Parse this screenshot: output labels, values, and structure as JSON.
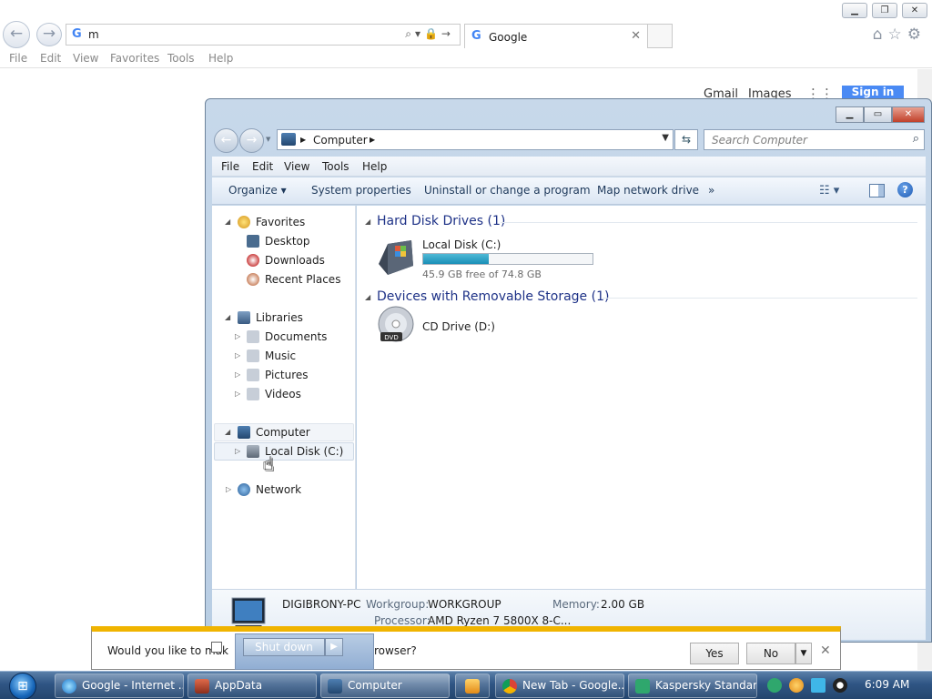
{
  "browser": {
    "address_value": "m",
    "tab_title": "Google",
    "menu": [
      "File",
      "Edit",
      "View",
      "Favorites",
      "Tools",
      "Help"
    ],
    "google_links": [
      "Gmail",
      "Images"
    ],
    "google_signin": "Sign in"
  },
  "explorer": {
    "breadcrumb": "Computer",
    "search_placeholder": "Search Computer",
    "menu": [
      "File",
      "Edit",
      "View",
      "Tools",
      "Help"
    ],
    "toolbar": [
      "Organize ▾",
      "System properties",
      "Uninstall or change a program",
      "Map network drive",
      "»"
    ],
    "nav": {
      "favorites": {
        "label": "Favorites",
        "items": [
          "Desktop",
          "Downloads",
          "Recent Places"
        ]
      },
      "libraries": {
        "label": "Libraries",
        "items": [
          "Documents",
          "Music",
          "Pictures",
          "Videos"
        ]
      },
      "computer": {
        "label": "Computer",
        "items": [
          "Local Disk (C:)"
        ]
      },
      "network": {
        "label": "Network"
      }
    },
    "groups": {
      "hdd_title": "Hard Disk Drives (1)",
      "removable_title": "Devices with Removable Storage (1)"
    },
    "drives": {
      "c": {
        "name": "Local Disk (C:)",
        "free_text": "45.9 GB free of 74.8 GB",
        "used_fraction": 0.386
      },
      "d": {
        "name": "CD Drive (D:)"
      }
    },
    "details": {
      "pc_name": "DIGIBRONY-PC",
      "workgroup_label": "Workgroup:",
      "workgroup_value": "WORKGROUP",
      "memory_label": "Memory:",
      "memory_value": "2.00 GB",
      "processor_label": "Processor:",
      "processor_value": "AMD Ryzen 7 5800X 8-C..."
    }
  },
  "prompt": {
    "message_start": "Would you like to mak",
    "message_end": "rowser?",
    "yes": "Yes",
    "no": "No",
    "shutdown_label": "Shut down"
  },
  "taskbar": {
    "items": [
      "Google - Internet ...",
      "AppData",
      "Computer",
      "New Tab - Google...",
      "Kaspersky Standard"
    ],
    "clock": "6:09 AM"
  },
  "colors": {
    "accent": "#1e3287",
    "drive_fill": "#1a8fb7",
    "prompt_border": "#f0b400",
    "taskbar": "#2f5584"
  }
}
